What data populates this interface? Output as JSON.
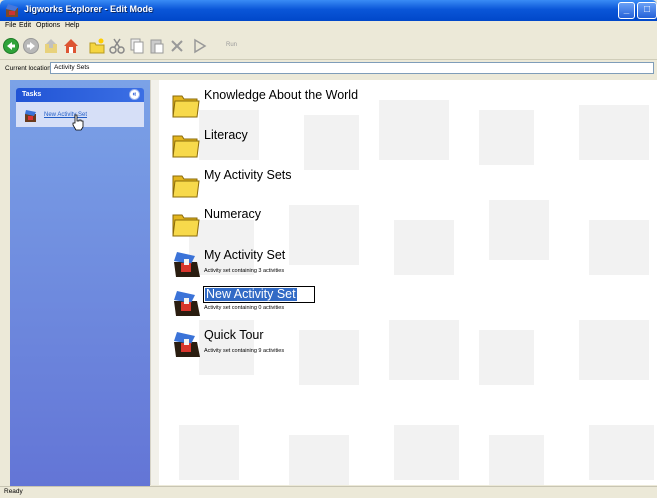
{
  "window": {
    "title": "Jigworks Explorer - Edit Mode"
  },
  "menu": [
    "File",
    "Edit",
    "Options",
    "Help"
  ],
  "toolbar": {
    "run_label": "Run"
  },
  "address": {
    "label": "Current location:",
    "value": "Activity Sets"
  },
  "tasks": {
    "title": "Tasks",
    "collapse_symbol": "«",
    "new_activity_set": "New Activity Set"
  },
  "items": [
    {
      "name": "Knowledge About the World",
      "type": "folder",
      "description": ""
    },
    {
      "name": "Literacy",
      "type": "folder",
      "description": ""
    },
    {
      "name": "My Activity Sets",
      "type": "folder",
      "description": ""
    },
    {
      "name": "Numeracy",
      "type": "folder",
      "description": ""
    },
    {
      "name": "My Activity Set",
      "type": "activity-set",
      "description": "Activity set containing 3 activities"
    },
    {
      "name": "New Activity Set",
      "type": "activity-set",
      "description": "Activity set containing 0 activities",
      "renaming": true
    },
    {
      "name": "Quick Tour",
      "type": "activity-set",
      "description": "Activity set containing 9 activities"
    }
  ],
  "status": {
    "text": "Ready"
  },
  "colors": {
    "titlebar": "#0a56d8",
    "sidebar": "#7ba2e7",
    "selection": "#316ac5",
    "folder": "#f5d53f"
  }
}
